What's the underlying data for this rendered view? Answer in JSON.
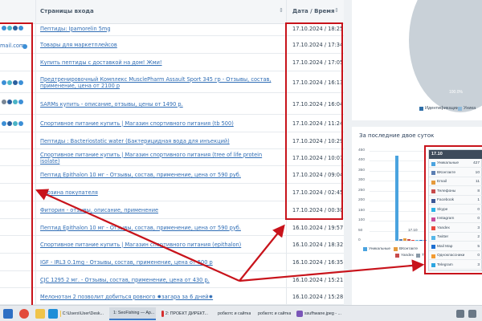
{
  "table": {
    "col_pages": "Страницы входа",
    "col_datetime": "Дата / Время",
    "left_partial_email": "mail.com",
    "rows": [
      {
        "link": "Пептиды: Ipamorelin 5mg",
        "date": "17.10.2024 / 18:25"
      },
      {
        "link": "Товары для маркетплейсов",
        "date": "17.10.2024 / 17:34"
      },
      {
        "link": "Купить пептиды с доставкой на дом! Жми!",
        "date": "17.10.2024 / 17:05"
      },
      {
        "link": "Предтренировочный Комплекс MusclePharm Assault Sport 345 гр - Отзывы, состав, применение, цена от 2100 р",
        "date": "17.10.2024 / 16:13"
      },
      {
        "link": "SARMs купить - описание, отзывы, цены от 1490 р.",
        "date": "17.10.2024 / 16:04"
      },
      {
        "link": "Спортивное питание купить | Магазин спортивного питания (tb 500)",
        "date": "17.10.2024 / 11:24"
      },
      {
        "link": "Пептиды : Bacteriostatic water (Бактерицидная вода для инъекций)",
        "date": "17.10.2024 / 10:29"
      },
      {
        "link": "Спортивное питание купить | Магазин спортивного питания (tree of life protein isolate)",
        "date": "17.10.2024 / 10:07"
      },
      {
        "link": "Пептид Epithalon 10 мг - Отзывы, состав, применение, цена от 590 руб.",
        "date": "17.10.2024 / 09:04"
      },
      {
        "link": "Корзина покупателя",
        "date": "17.10.2024 / 02:45"
      },
      {
        "link": "Фиторин - отзывы, описание, применение",
        "date": "17.10.2024 / 00:30"
      },
      {
        "link": "Пептид Epithalon 10 мг - Отзывы, состав, применение, цена от 590 руб.",
        "date": "16.10.2024 / 19:57"
      },
      {
        "link": "Спортивное питание купить | Магазин спортивного питания (epithalon)",
        "date": "16.10.2024 / 18:32"
      },
      {
        "link": "IGF - IRL3 0.1mg - Отзывы, состав, применение, цена от 500 р",
        "date": "16.10.2024 / 16:35"
      },
      {
        "link": "CJC 1295 2 мг. - Отзывы, состав, применение, цена от 430 р.",
        "date": "16.10.2024 / 15:21"
      },
      {
        "link": "Мелонотан 2 позволит добиться ровного ✹загара за 6 дней✹",
        "date": "16.10.2024 / 15:28"
      }
    ]
  },
  "pie": {
    "percent_label": "100.0%",
    "legend": [
      {
        "label": "Идентификации",
        "color": "#2f6fa8"
      },
      {
        "label": "Уника",
        "color": "#8fb8d8"
      }
    ]
  },
  "bar_panel": {
    "title": "За последние двое суток",
    "y_ticks": [
      "450",
      "400",
      "350",
      "300",
      "250",
      "200",
      "150",
      "100",
      "50",
      "0"
    ],
    "x_label_partial": "17.10",
    "legend": [
      {
        "label": "Уникальные",
        "color": "#4aa3df"
      },
      {
        "label": "ВКонтакте",
        "color": "#e59a3c"
      },
      {
        "label": "Yandex",
        "color": "#c84b4b"
      },
      {
        "label": "Т",
        "color": "#8a9aa8"
      }
    ]
  },
  "chart_data": {
    "type": "bar",
    "categories": [
      "17.10"
    ],
    "series": [
      {
        "name": "Уникальные",
        "values": [
          427
        ]
      },
      {
        "name": "ВКонтакте",
        "values": [
          10
        ]
      },
      {
        "name": "Email",
        "values": [
          11
        ]
      },
      {
        "name": "Телефоны",
        "values": [
          8
        ]
      },
      {
        "name": "Yandex",
        "values": [
          3
        ]
      },
      {
        "name": "Twitter",
        "values": [
          2
        ]
      },
      {
        "name": "Mail Map",
        "values": [
          5
        ]
      },
      {
        "name": "Telegram",
        "values": [
          3
        ]
      }
    ],
    "ylim": [
      0,
      450
    ]
  },
  "tooltip": {
    "header": "17.10",
    "rows": [
      {
        "name": "Уникальные",
        "value": "427",
        "color": "#4aa3df"
      },
      {
        "name": "ВКонтакте",
        "value": "10",
        "color": "#5b7fb3"
      },
      {
        "name": "Email",
        "value": "11",
        "color": "#e59a3c"
      },
      {
        "name": "Телефоны",
        "value": "8",
        "color": "#c84b4b"
      },
      {
        "name": "Facebook",
        "value": "1",
        "color": "#3b5998"
      },
      {
        "name": "Skype",
        "value": "0",
        "color": "#2bb2e6"
      },
      {
        "name": "Instagram",
        "value": "0",
        "color": "#c94c9b"
      },
      {
        "name": "Yandex",
        "value": "3",
        "color": "#e9473d"
      },
      {
        "name": "Twitter",
        "value": "2",
        "color": "#56b7e8"
      },
      {
        "name": "Mail Map",
        "value": "5",
        "color": "#1d6fd1"
      },
      {
        "name": "Одноклассники",
        "value": "0",
        "color": "#f29b31"
      },
      {
        "name": "Telegram",
        "value": "3",
        "color": "#2ca5e0"
      }
    ]
  },
  "taskbar": {
    "items": [
      {
        "label": "C:\\Users\\User\\Desk...",
        "color": "#f0c44a"
      },
      {
        "label": "1: SeoFishing — Ap...",
        "color": "#c0392b"
      },
      {
        "label": "2: ПРОЕКТ ДИРЕКТ...",
        "color": "#d62f2f"
      },
      {
        "label": "робкотс и сайтка...",
        "color": "#2d7bc8"
      },
      {
        "label": "робкотс и сайтка...",
        "color": "#2d7bc8"
      },
      {
        "label": "ssufhwane.jpeg - ...",
        "color": "#7a56b8"
      }
    ]
  }
}
